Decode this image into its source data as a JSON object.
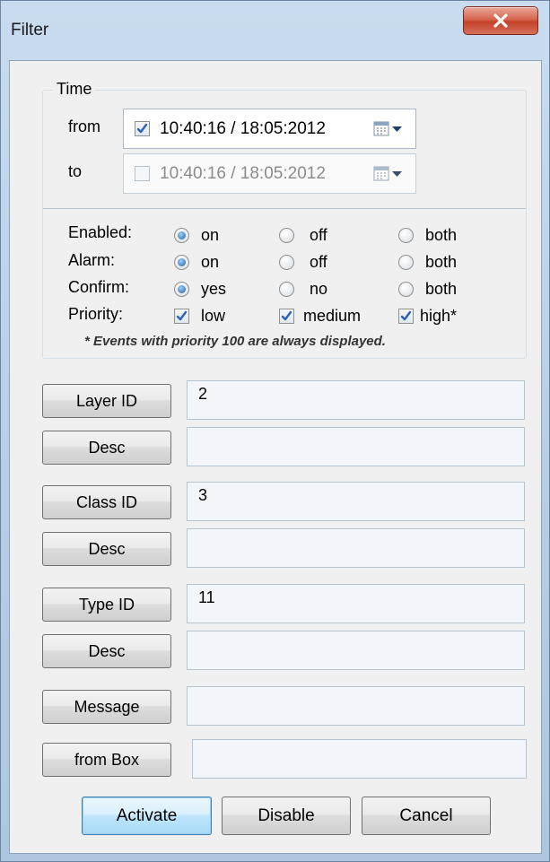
{
  "window": {
    "title": "Filter",
    "close_icon": "close-x-icon"
  },
  "time": {
    "group_label": "Time",
    "from_label": "from",
    "to_label": "to",
    "from_value": "10:40:16 / 18:05:2012",
    "to_value": "10:40:16 / 18:05:2012",
    "from_checked": true,
    "to_checked": false
  },
  "options": {
    "enabled": {
      "label": "Enabled:",
      "choices": [
        "on",
        "off",
        "both"
      ],
      "selected": "on"
    },
    "alarm": {
      "label": "Alarm:",
      "choices": [
        "on",
        "off",
        "both"
      ],
      "selected": "on"
    },
    "confirm": {
      "label": "Confirm:",
      "choices": [
        "yes",
        "no",
        "both"
      ],
      "selected": "yes"
    },
    "priority": {
      "label": "Priority:",
      "choices": [
        "low",
        "medium",
        "high*"
      ],
      "checked": [
        true,
        true,
        true
      ]
    },
    "note": "* Events with priority 100 are always displayed."
  },
  "filters": {
    "layer_id": {
      "button": "Layer ID",
      "value": "2"
    },
    "layer_desc": {
      "button": "Desc",
      "value": ""
    },
    "class_id": {
      "button": "Class ID",
      "value": "3"
    },
    "class_desc": {
      "button": "Desc",
      "value": ""
    },
    "type_id": {
      "button": "Type ID",
      "value": "11"
    },
    "type_desc": {
      "button": "Desc",
      "value": ""
    },
    "message": {
      "button": "Message",
      "value": ""
    },
    "from_box": {
      "button": "from Box",
      "value": ""
    }
  },
  "actions": {
    "activate": "Activate",
    "disable": "Disable",
    "cancel": "Cancel"
  },
  "colors": {
    "accent": "#1c5fa6",
    "close": "#c4412a",
    "check": "#2b64b5"
  }
}
